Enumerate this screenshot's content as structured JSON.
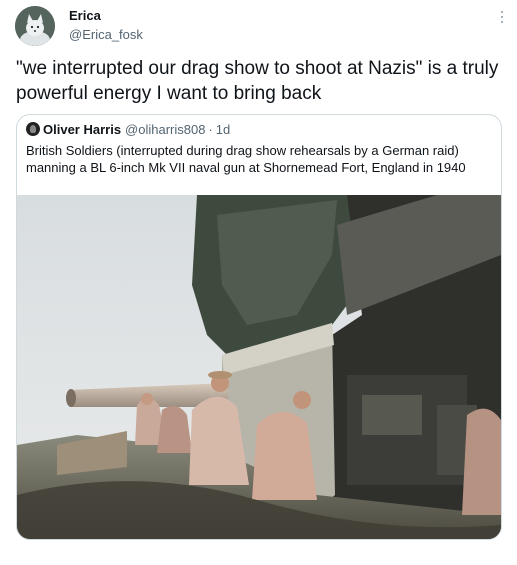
{
  "author": {
    "name": "Erica",
    "handle": "@Erica_fosk",
    "avatar_icon": "arctic-fox-avatar-icon"
  },
  "tweet": {
    "text": "\"we interrupted our drag show to shoot at Nazis\" is a truly powerful energy I want to bring back"
  },
  "quote": {
    "name": "Oliver Harris",
    "handle": "@oliharris808",
    "separator": "·",
    "age": "1d",
    "text": "British Soldiers (interrupted during drag show rehearsals by a German raid) manning a BL 6-inch Mk VII naval gun at Shornemead Fort, England in 1940"
  },
  "colors": {
    "handle_gray": "#536471",
    "border": "#cfd9de"
  }
}
